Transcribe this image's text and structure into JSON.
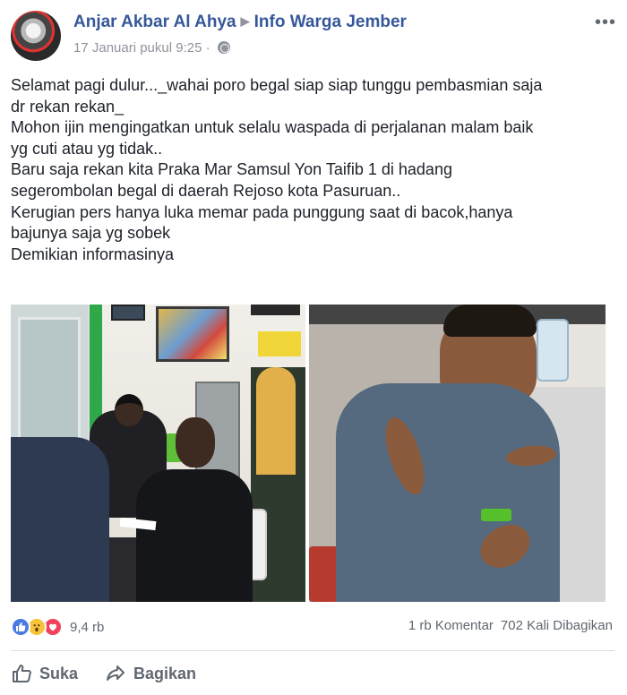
{
  "post": {
    "author": "Anjar Akbar Al Ahya",
    "group": "Info Warga Jember",
    "timestamp": "17 Januari pukul 9:25",
    "separator": "·",
    "more_icon": "more-horizontal-icon",
    "body_lines": [
      "Selamat pagi dulur..._wahai poro begal siap siap tunggu pembasmian saja",
      "dr rekan rekan_",
      "Mohon ijin mengingatkan untuk selalu waspada di perjalanan malam baik",
      "yg cuti atau yg tidak..",
      "Baru saja rekan kita Praka Mar Samsul Yon Taifib 1 di hadang",
      "segerombolan begal di daerah Rejoso kota Pasuruan..",
      "Kerugian pers hanya luka memar pada punggung saat di bacok,hanya",
      "bajunya saja yg sobek",
      "Demikian informasinya"
    ]
  },
  "reactions": {
    "icons": [
      "like-reaction-icon",
      "wow-reaction-icon",
      "love-reaction-icon"
    ],
    "count": "9,4 rb",
    "comments": "1 rb Komentar",
    "shares": "702 Kali Dibagikan"
  },
  "actions": {
    "like_label": "Suka",
    "share_label": "Bagikan"
  },
  "colors": {
    "link": "#365899",
    "meta": "#90949c",
    "action": "#606770",
    "like": "#4a7be0",
    "wow": "#f6c33b",
    "love": "#f0425a"
  }
}
